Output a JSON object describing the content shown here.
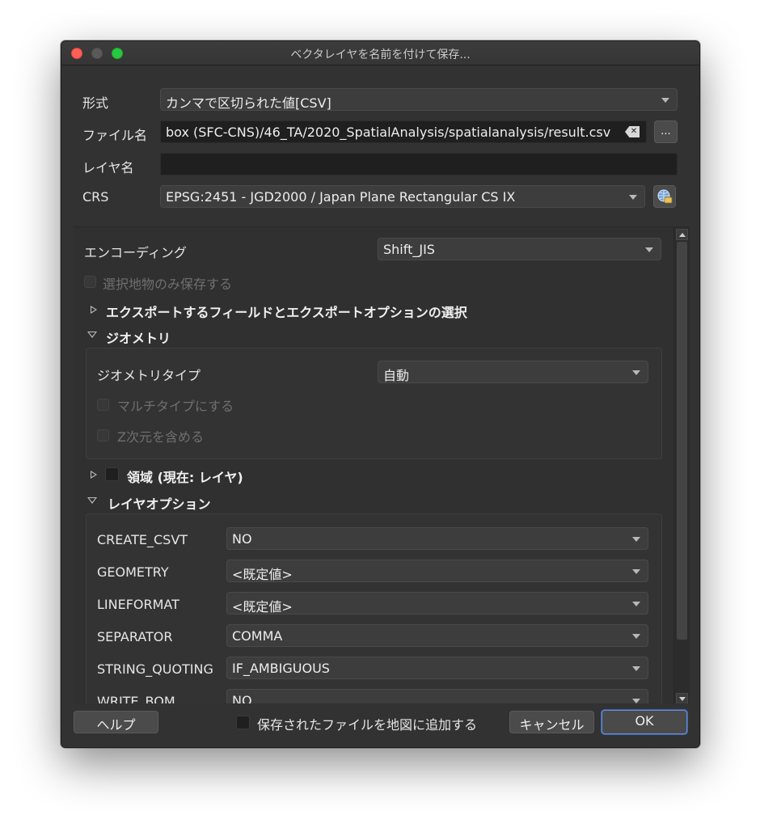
{
  "window": {
    "title": "ベクタレイヤを名前を付けて保存..."
  },
  "form": {
    "format": {
      "label": "形式",
      "value": "カンマで区切られた値[CSV]"
    },
    "filename": {
      "label": "ファイル名",
      "value": "box (SFC-CNS)/46_TA/2020_SpatialAnalysis/spatialanalysis/result.csv",
      "browse_label": "..."
    },
    "layername": {
      "label": "レイヤ名",
      "value": ""
    },
    "crs": {
      "label": "CRS",
      "value": "EPSG:2451 - JGD2000 / Japan Plane Rectangular CS IX"
    }
  },
  "options": {
    "encoding": {
      "label": "エンコーディング",
      "value": "Shift_JIS"
    },
    "selected_only": {
      "label": "選択地物のみ保存する"
    },
    "export_fields": {
      "label": "エクスポートするフィールドとエクスポートオプションの選択"
    },
    "geometry": {
      "label": "ジオメトリ",
      "type_label": "ジオメトリタイプ",
      "type_value": "自動",
      "multitype_label": "マルチタイプにする",
      "z_label": "Z次元を含める"
    },
    "extent": {
      "label": "領域 (現在: レイヤ)"
    },
    "layer_options": {
      "label": "レイヤオプション",
      "rows": [
        {
          "name": "CREATE_CSVT",
          "value": "NO"
        },
        {
          "name": "GEOMETRY",
          "value": "<既定値>"
        },
        {
          "name": "LINEFORMAT",
          "value": "<既定値>"
        },
        {
          "name": "SEPARATOR",
          "value": "COMMA"
        },
        {
          "name": "STRING_QUOTING",
          "value": "IF_AMBIGUOUS"
        },
        {
          "name": "WRITE_BOM",
          "value": "NO"
        }
      ]
    }
  },
  "footer": {
    "help": "ヘルプ",
    "add_to_map": "保存されたファイルを地図に追加する",
    "cancel": "キャンセル",
    "ok": "OK"
  },
  "colors": {
    "window_bg": "#323232",
    "field_bg": "#1f1f1f",
    "ok_focus": "#3a66b4"
  }
}
